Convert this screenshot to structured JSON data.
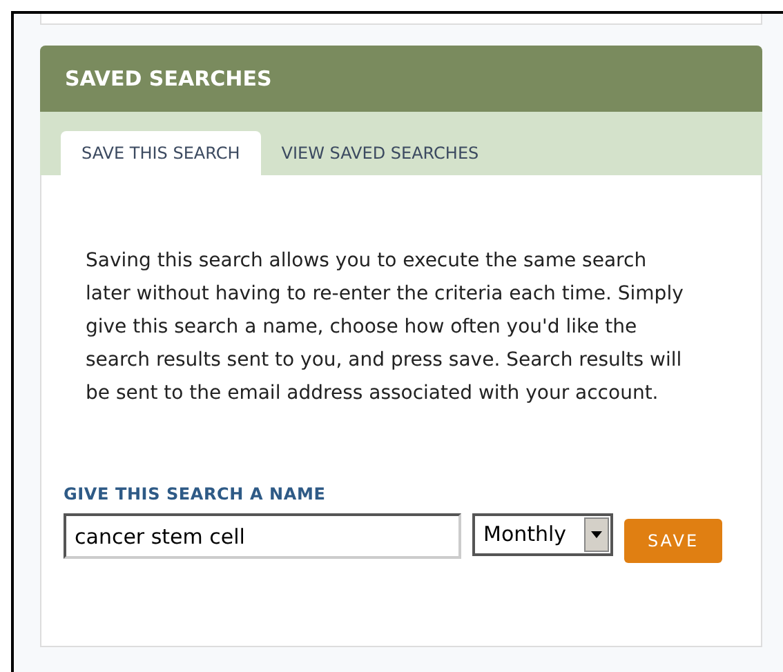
{
  "panel": {
    "title": "SAVED SEARCHES"
  },
  "tabs": [
    {
      "label": "SAVE THIS SEARCH",
      "selected": true
    },
    {
      "label": "VIEW SAVED SEARCHES",
      "selected": false
    }
  ],
  "description": "Saving this search allows you to execute the same search later without having to re-enter the criteria each time. Simply give this search a name, choose how often you'd like the search results sent to you, and press save. Search results will be sent to the email address associated with your account.",
  "form": {
    "label": "GIVE THIS SEARCH A NAME",
    "name_value": "cancer stem cell",
    "frequency": "Monthly",
    "button": "SAVE"
  }
}
